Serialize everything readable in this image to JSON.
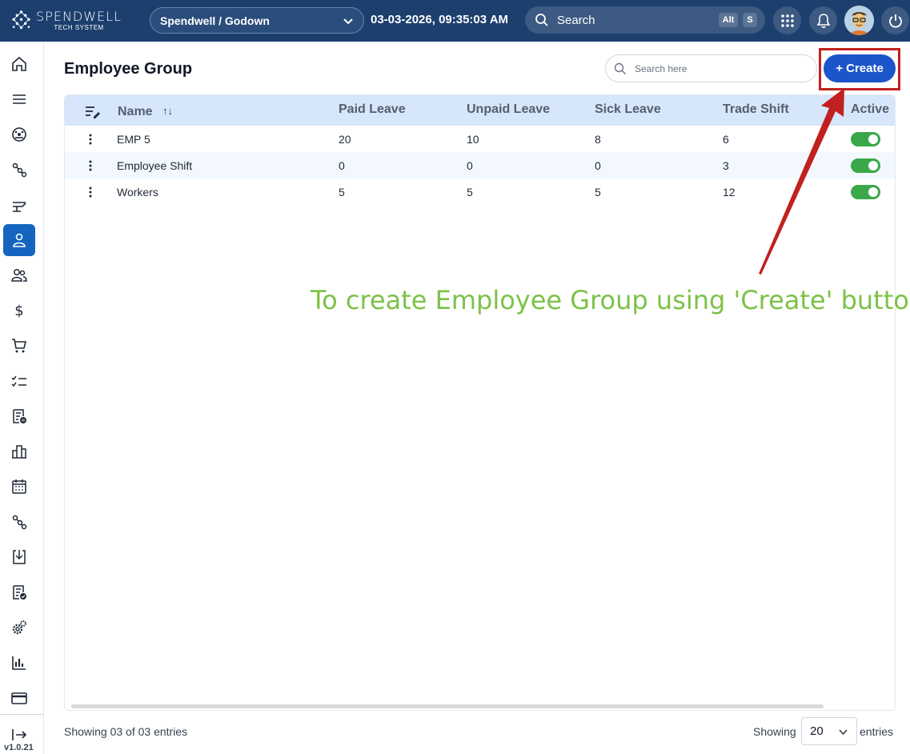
{
  "header": {
    "logo_name": "SPENDWELL",
    "logo_sub": "TECH SYSTEM",
    "branch": "Spendwell / Godown",
    "datetime": "03-03-2026, 09:35:03 AM",
    "search_label": "Search",
    "shortcut_alt": "Alt",
    "shortcut_key": "S"
  },
  "sidebar": {
    "items": [
      {
        "icon": "home-icon"
      },
      {
        "icon": "menu-icon"
      },
      {
        "icon": "dashboard-gauge-icon"
      },
      {
        "icon": "workflow-icon"
      },
      {
        "icon": "fork-lift-icon"
      },
      {
        "icon": "employee-icon",
        "active": true
      },
      {
        "icon": "users-icon"
      },
      {
        "icon": "dollar-icon"
      },
      {
        "icon": "cart-icon"
      },
      {
        "icon": "checklist-icon"
      },
      {
        "icon": "report-pause-icon"
      },
      {
        "icon": "buildings-icon"
      },
      {
        "icon": "calendar-icon"
      },
      {
        "icon": "workflow-icon"
      },
      {
        "icon": "download-tray-icon"
      },
      {
        "icon": "document-check-icon"
      },
      {
        "icon": "settings-gears-icon"
      },
      {
        "icon": "bar-chart-icon"
      },
      {
        "icon": "credit-card-icon"
      }
    ],
    "logout_icon": "logout-icon",
    "version": "v1.0.21"
  },
  "page": {
    "title": "Employee Group",
    "search_placeholder": "Search here",
    "create_label": "+ Create"
  },
  "table": {
    "columns": [
      "Name",
      "Paid Leave",
      "Unpaid Leave",
      "Sick Leave",
      "Trade Shift",
      "Active"
    ],
    "sort_indicator": "↑↓",
    "rows": [
      {
        "name": "EMP 5",
        "paid_leave": "20",
        "unpaid_leave": "10",
        "sick_leave": "8",
        "trade_shift": "6",
        "active": true
      },
      {
        "name": "Employee Shift",
        "paid_leave": "0",
        "unpaid_leave": "0",
        "sick_leave": "0",
        "trade_shift": "3",
        "active": true
      },
      {
        "name": "Workers",
        "paid_leave": "5",
        "unpaid_leave": "5",
        "sick_leave": "5",
        "trade_shift": "12",
        "active": true
      }
    ]
  },
  "footer": {
    "showing_text": "Showing 03 of 03 entries",
    "showing_label": "Showing",
    "page_size": "20",
    "entries_label": "entries"
  },
  "annotation": {
    "text": "To create Employee Group using 'Create' button",
    "color": "#7cc247",
    "arrow_color": "#c0211f"
  },
  "colors": {
    "header_bg": "#1c3f6e",
    "accent": "#1a56c9",
    "active_sidebar": "#1565c0",
    "table_header_bg": "#d6e6fb",
    "toggle_on": "#3aa84a"
  }
}
